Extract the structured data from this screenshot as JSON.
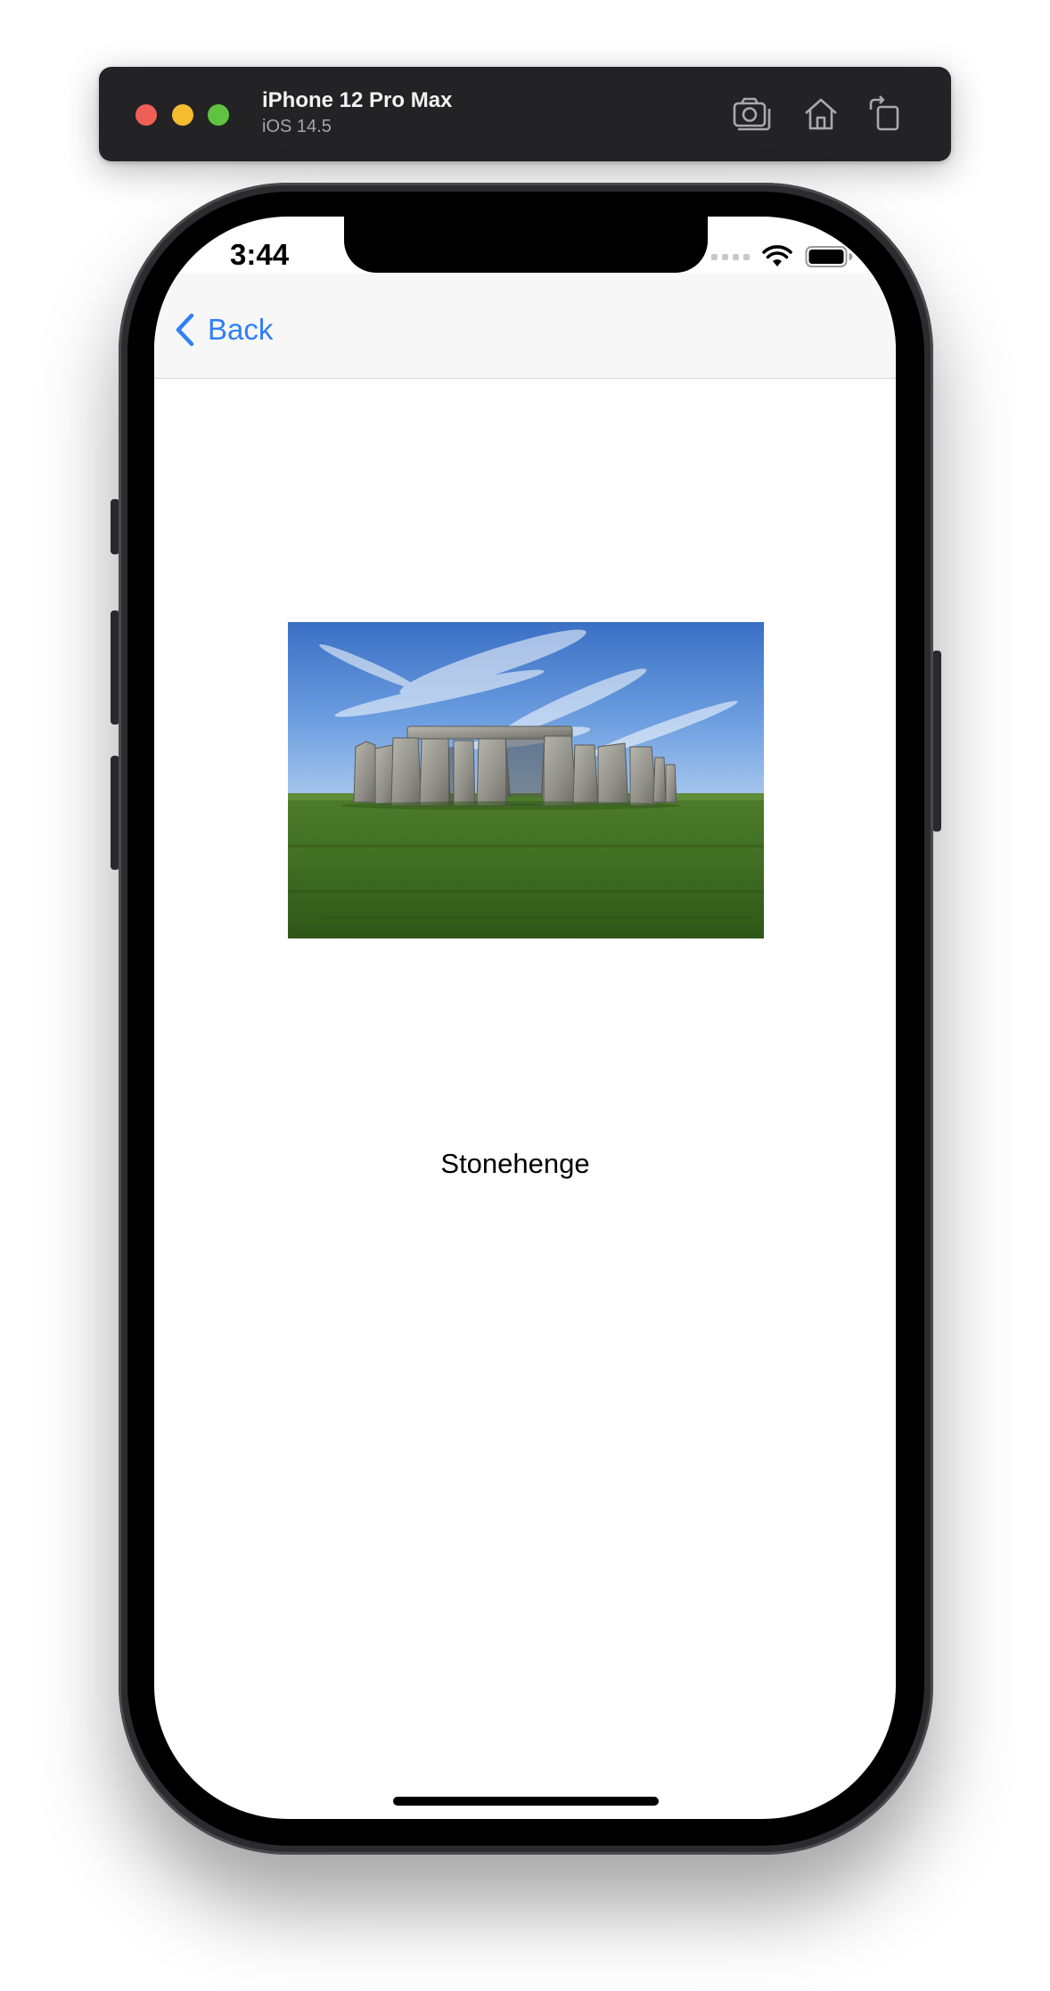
{
  "simulator": {
    "device_name": "iPhone 12 Pro Max",
    "os_version": "iOS 14.5",
    "toolbar_icons": [
      "screenshot-icon",
      "home-icon",
      "rotate-icon"
    ],
    "traffic_light_colors": [
      "#ee5f57",
      "#f5bc2f",
      "#5fc341"
    ]
  },
  "status_bar": {
    "time": "3:44",
    "icons": [
      "cellular-signal-icon",
      "wifi-icon",
      "battery-icon"
    ]
  },
  "navigation": {
    "back_label": "Back",
    "accent_color": "#2f7ff6"
  },
  "content": {
    "image_subject": "stonehenge-photo",
    "caption": "Stonehenge"
  }
}
